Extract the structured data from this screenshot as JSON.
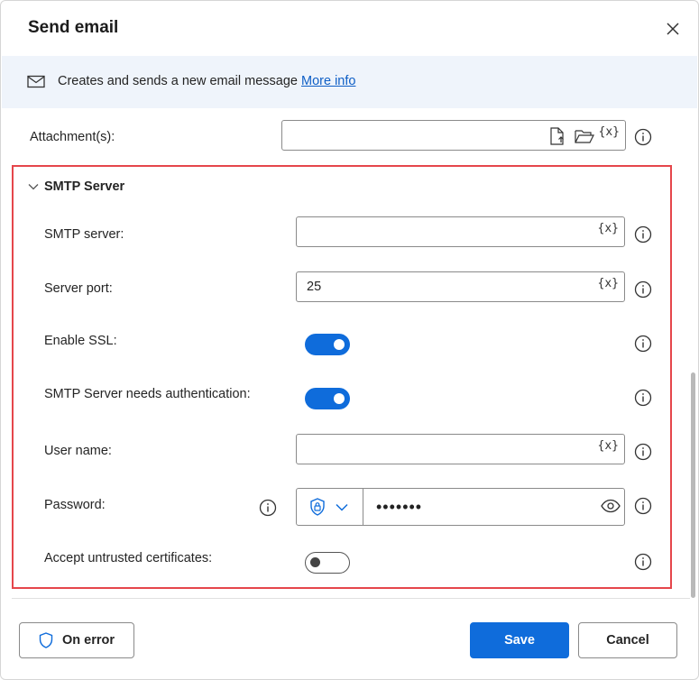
{
  "dialog": {
    "title": "Send email",
    "close_icon": "close-icon"
  },
  "banner": {
    "icon": "mail-icon",
    "description": "Creates and sends a new email message",
    "more_link": "More info"
  },
  "fields": {
    "attachments": {
      "label": "Attachment(s):",
      "value": ""
    },
    "smtp_section": {
      "title": "SMTP Server",
      "expanded": true
    },
    "smtp_server": {
      "label": "SMTP server:",
      "value": ""
    },
    "server_port": {
      "label": "Server port:",
      "value": "25"
    },
    "enable_ssl": {
      "label": "Enable SSL:",
      "on": true
    },
    "needs_auth": {
      "label": "SMTP Server needs authentication:",
      "on": true
    },
    "user_name": {
      "label": "User name:",
      "value": ""
    },
    "password": {
      "label": "Password:",
      "masked": "•••••••"
    },
    "accept_untrusted": {
      "label": "Accept untrusted certificates:",
      "on": false
    }
  },
  "variable_token": "{x}",
  "footer": {
    "on_error": "On error",
    "save": "Save",
    "cancel": "Cancel"
  },
  "colors": {
    "accent": "#0f6cdb",
    "highlight_border": "#e5464b",
    "banner_bg": "#eff4fb",
    "link": "#0f5fc6"
  }
}
